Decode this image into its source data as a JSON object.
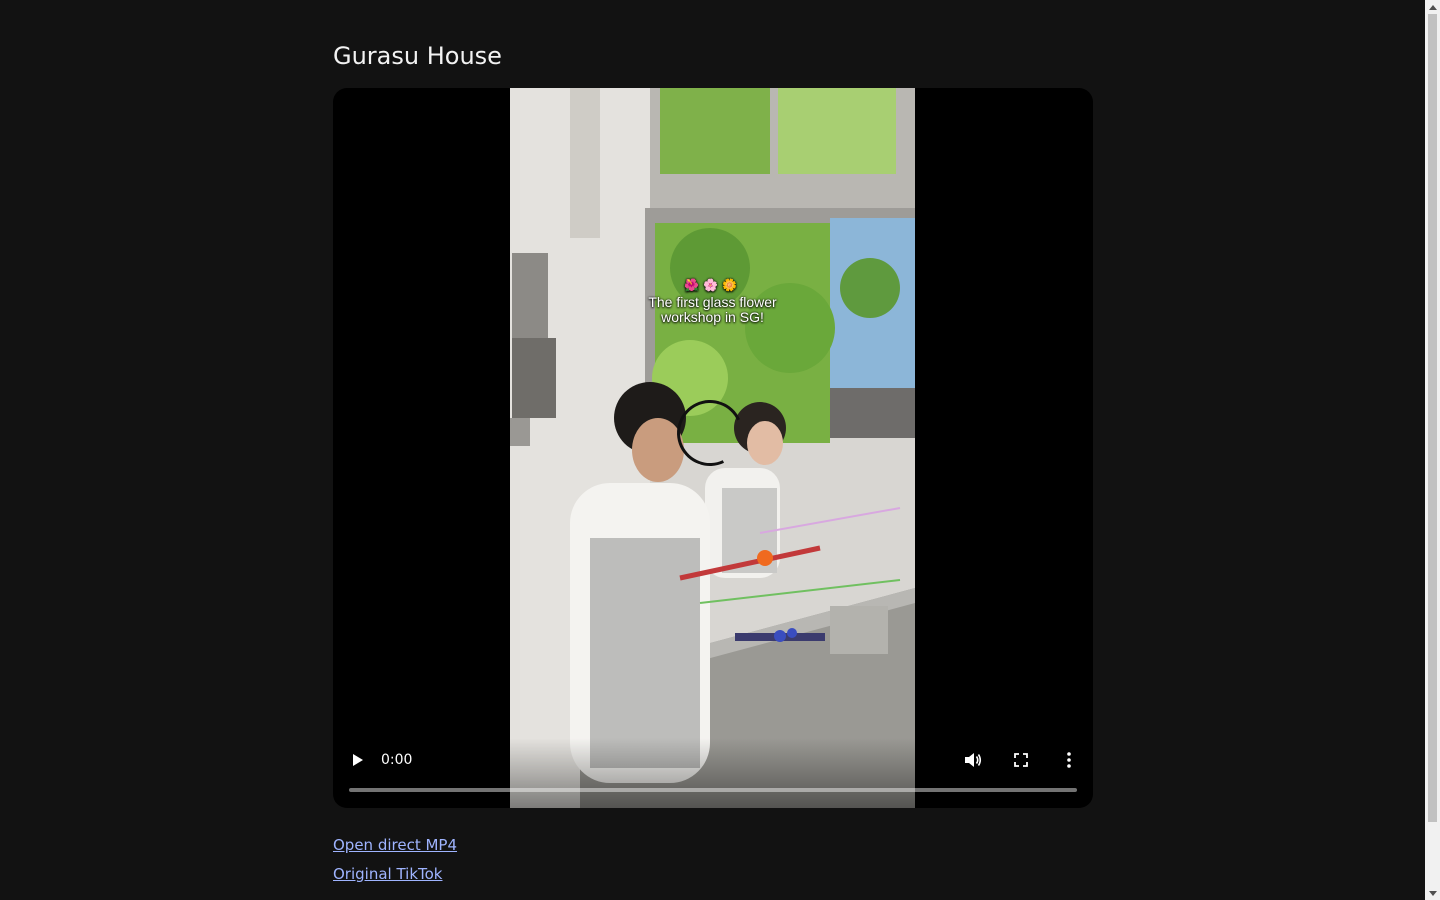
{
  "page": {
    "title": "Gurasu House"
  },
  "video": {
    "caption_emoji": "🌺🌸🌼",
    "caption_line1": "The first glass flower",
    "caption_line2": "workshop in SG!",
    "current_time": "0:00",
    "progress_fraction": 0,
    "play_icon": "play-icon",
    "volume_icon": "volume-icon",
    "fullscreen_icon": "fullscreen-icon",
    "more_icon": "more-vertical-icon"
  },
  "links": {
    "direct_mp4": "Open direct MP4",
    "original_tiktok": "Original TikTok"
  },
  "colors": {
    "background": "#121212",
    "link": "#9fb4ff",
    "player_bg": "#000000"
  }
}
